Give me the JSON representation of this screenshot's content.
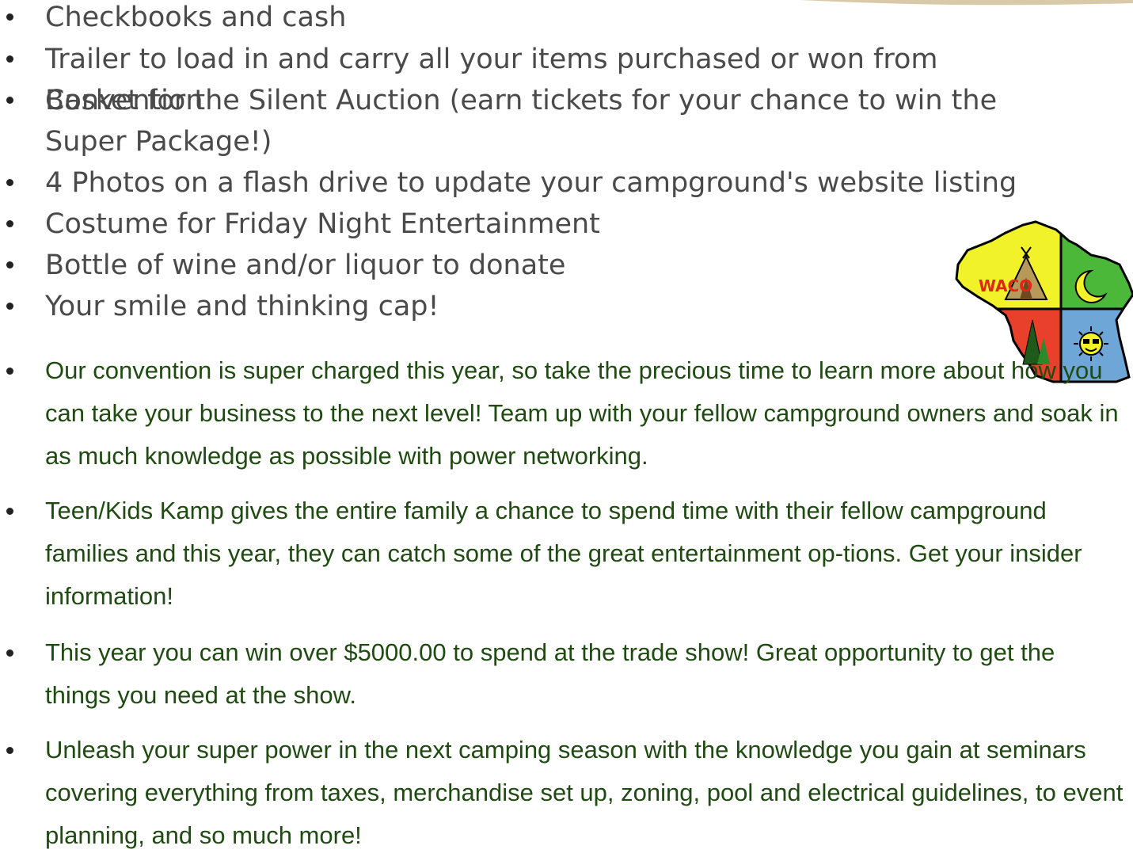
{
  "supplies_list": [
    "Checkbooks and cash",
    "Trailer to load in and carry all your items purchased or won from Convention",
    "Basket for the Silent Auction (earn tickets for your chance to win the Super Package!)",
    "4 Photos on a flash drive to update your campground's website listing",
    "Costume for Friday Night Entertainment",
    "Bottle of wine and/or liquor to donate",
    "Your smile and thinking cap!"
  ],
  "highlights": [
    "Our convention is super charged this year, so take the precious time to learn more about how you can take your business to the next level!  Team up with your fellow campground owners and soak in as much knowledge as possible with power networking.",
    "Teen/Kids Kamp gives the entire family a chance to spend time with their fellow campground families and  this year, they can catch some of the great entertainment op-tions.  Get your insider information!",
    "This year you can win over $5000.00 to spend at the trade show! Great opportunity to get the things you need at the show.",
    "Unleash your super power in the next camping season with the knowledge you gain at seminars covering everything from taxes, merchandise set up, zoning, pool and electrical guidelines, to event planning, and so much more!"
  ],
  "logo": {
    "text": "WACO",
    "colors": {
      "yellow": "#f2f22a",
      "green": "#4cb83a",
      "red": "#e8402a",
      "blue": "#6fa6d8",
      "text_red": "#e02818"
    }
  },
  "colors": {
    "gray_text": "#4a4a4a",
    "green_text": "#1f4a12"
  }
}
